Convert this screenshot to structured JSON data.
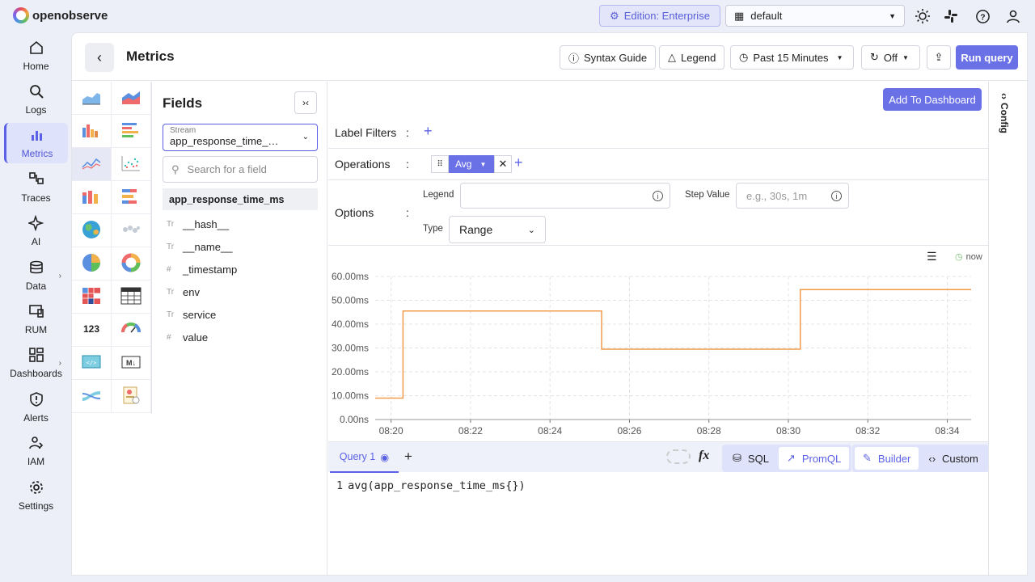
{
  "app": {
    "logo_text": "openobserve"
  },
  "topbar": {
    "edition": "Edition: Enterprise",
    "org": "default"
  },
  "nav": [
    {
      "label": "Home",
      "icon": "home-icon"
    },
    {
      "label": "Logs",
      "icon": "search-icon"
    },
    {
      "label": "Metrics",
      "icon": "bar-chart-icon",
      "active": true
    },
    {
      "label": "Traces",
      "icon": "traces-icon"
    },
    {
      "label": "AI",
      "icon": "sparkle-icon"
    },
    {
      "label": "Data",
      "icon": "database-icon",
      "expand": true
    },
    {
      "label": "RUM",
      "icon": "devices-icon"
    },
    {
      "label": "Dashboards",
      "icon": "dashboard-icon",
      "expand": true
    },
    {
      "label": "Alerts",
      "icon": "alert-shield-icon"
    },
    {
      "label": "IAM",
      "icon": "users-icon"
    },
    {
      "label": "Settings",
      "icon": "gear-icon"
    }
  ],
  "header": {
    "title": "Metrics",
    "syntax_guide": "Syntax Guide",
    "legend": "Legend",
    "time_range": "Past 15 Minutes",
    "refresh": "Off",
    "run_query": "Run query"
  },
  "fields": {
    "title": "Fields",
    "stream_label": "Stream",
    "stream_value": "app_response_time_…",
    "search_placeholder": "Search for a field",
    "selected": "app_response_time_ms",
    "items": [
      {
        "type": "Tr",
        "name": "__hash__"
      },
      {
        "type": "Tr",
        "name": "__name__"
      },
      {
        "type": "#",
        "name": "_timestamp"
      },
      {
        "type": "Tr",
        "name": "env"
      },
      {
        "type": "Tr",
        "name": "service"
      },
      {
        "type": "#",
        "name": "value"
      }
    ]
  },
  "query": {
    "add_to_dashboard": "Add To Dashboard",
    "label_filters": "Label Filters",
    "operations": "Operations",
    "operation_value": "Avg",
    "options": "Options",
    "legend_label": "Legend",
    "step_label": "Step Value",
    "step_placeholder": "e.g., 30s, 1m",
    "type_label": "Type",
    "type_value": "Range",
    "now_label": "now",
    "tab": "Query 1",
    "sql": "SQL",
    "promql": "PromQL",
    "builder": "Builder",
    "custom": "Custom",
    "code_line_no": "1",
    "code": "avg(app_response_time_ms{})"
  },
  "config_label": "Config",
  "colors": {
    "accent": "#6a70e6",
    "series": "#f09a4a"
  },
  "chart_data": {
    "type": "line",
    "step": true,
    "x_ticks": [
      "08:20",
      "08:22",
      "08:24",
      "08:26",
      "08:28",
      "08:30",
      "08:32",
      "08:34"
    ],
    "y_ticks": [
      "0.00ns",
      "10.00ms",
      "20.00ms",
      "30.00ms",
      "40.00ms",
      "50.00ms",
      "60.00ms"
    ],
    "ylim": [
      0,
      60
    ],
    "xlim": [
      "08:19.6",
      "08:34.6"
    ],
    "series": [
      {
        "x": [
          "08:19.6",
          "08:20.3",
          "08:25.3",
          "08:30.3",
          "08:34.6"
        ],
        "values": [
          9,
          45.5,
          29.5,
          54.5,
          54.5
        ]
      }
    ],
    "grid": true
  }
}
